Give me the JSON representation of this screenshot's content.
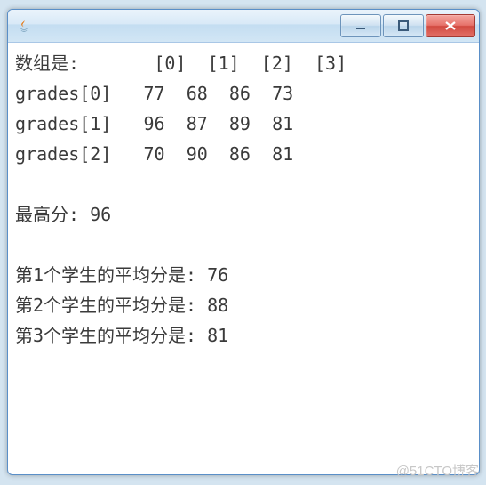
{
  "header_label": "数组是:",
  "col_headers": [
    "[0]",
    "[1]",
    "[2]",
    "[3]"
  ],
  "rows": [
    {
      "label": "grades[0]",
      "values": [
        77,
        68,
        86,
        73
      ]
    },
    {
      "label": "grades[1]",
      "values": [
        96,
        87,
        89,
        81
      ]
    },
    {
      "label": "grades[2]",
      "values": [
        70,
        90,
        86,
        81
      ]
    }
  ],
  "highest": {
    "label": "最高分:",
    "value": 96
  },
  "averages": [
    {
      "label": "第1个学生的平均分是:",
      "value": 76
    },
    {
      "label": "第2个学生的平均分是:",
      "value": 88
    },
    {
      "label": "第3个学生的平均分是:",
      "value": 81
    }
  ],
  "watermark": "@51CTO博客",
  "chart_data": {
    "type": "table",
    "title": "数组是:",
    "categories": [
      "[0]",
      "[1]",
      "[2]",
      "[3]"
    ],
    "series": [
      {
        "name": "grades[0]",
        "values": [
          77,
          68,
          86,
          73
        ]
      },
      {
        "name": "grades[1]",
        "values": [
          96,
          87,
          89,
          81
        ]
      },
      {
        "name": "grades[2]",
        "values": [
          70,
          90,
          86,
          81
        ]
      }
    ],
    "max": 96,
    "averages_per_row": [
      76,
      88,
      81
    ]
  }
}
